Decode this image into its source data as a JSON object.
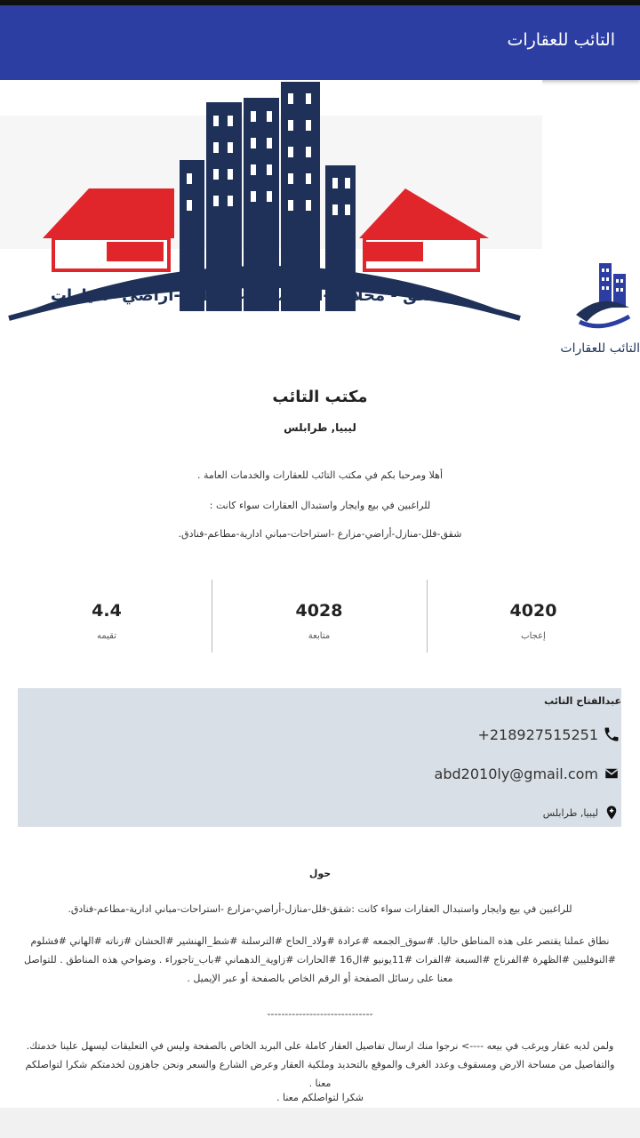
{
  "app_bar": {
    "title": "التائب للعقارات"
  },
  "cover": {
    "tagline": "شقق - محلات -استثمار - عقارات -اراضي -سيارات"
  },
  "profile_logo": {
    "text": "التائب للعقارات"
  },
  "page": {
    "name": "مكتب التائب",
    "location": "ليبيا, طرابلس",
    "intro": [
      "أهلا ومرحبا بكم في مكتب التائب للعقارات والخدمات العامة .",
      "للراغبين في بيع وايجار واستبدال العقارات سواء كانت :",
      "شقق-فلل-منازل-أراضي-مزارع -استراحات-مباني ادارية-مطاعم-فنادق."
    ]
  },
  "stats": [
    {
      "value": "4020",
      "label": "إعجاب"
    },
    {
      "value": "4028",
      "label": "متابعة"
    },
    {
      "value": "4.4",
      "label": "تقيمه"
    }
  ],
  "contact": {
    "title": "عبدالفتاح التائب",
    "phone": "+218927515251",
    "email": "abd2010ly@gmail.com",
    "address": "ليبيا, طرابلس"
  },
  "about": {
    "title": "حول",
    "paragraphs": [
      "للراغبين في بيع وايجار واستبدال العقارات سواء كانت :شقق-فلل-منازل-أراضي-مزارع -استراحات-مباني ادارية-مطاعم-فنادق.",
      "نطاق عملنا يقتصر على هذه المناطق حاليا. #سوق_الجمعه #عرادة #ولاد_الحاج #الترسلنة #شط_الهنشير #الحشان #زناته #الهاني #فشلوم #النوفليين #الظهرة #الفرناج #السبعة #الفرات #11يونيو #ال16 #الحارات #زاوية_الدهماني #باب_تاجوراء . وضواحي هذه المناطق . للتواصل معنا على رسائل الصفحة أو الرقم الخاص بالصفحة أو عبر الإيميل .",
      "------------------------------",
      "ولمن لديه عقار ويرغب في بيعه ----> نرجوا منك ارسال تفاصيل العقار كاملة على البريد الخاص بالصفحة وليس في التعليقات ليسهل علينا خدمتك. والتفاصيل من مساحة الارض ومسقوف وعدد الغرف والموقع بالتحديد وملكية العقار وعرض الشارع والسعر ونحن جاهزون لخدمتكم شكرا لتواصلكم معنا .",
      "شكرا لتواصلكم معنا ."
    ]
  },
  "colors": {
    "app_bar": "#2d3ea3",
    "navy": "#1f3158",
    "roof_red": "#e0262b",
    "card": "#d9dfe6"
  }
}
